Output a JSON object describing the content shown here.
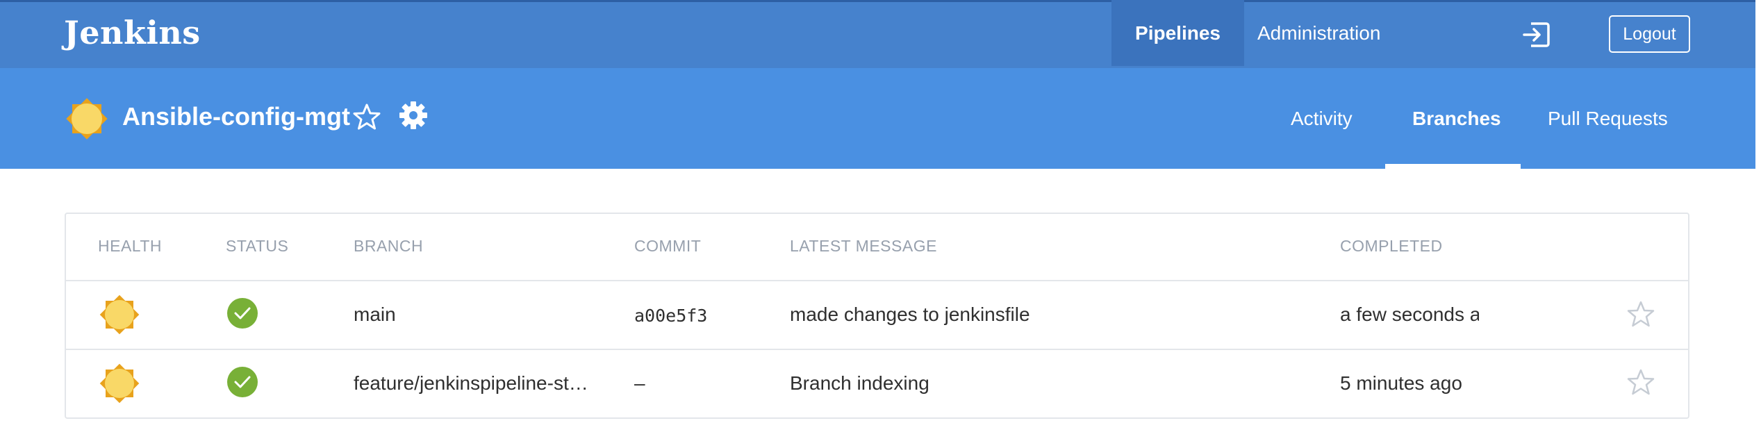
{
  "header": {
    "logo": "Jenkins",
    "nav": {
      "pipelines": "Pipelines",
      "administration": "Administration"
    },
    "logout_label": "Logout"
  },
  "pipeline": {
    "title": "Ansible-config-mgt",
    "tabs": [
      "Activity",
      "Branches",
      "Pull Requests"
    ],
    "active_tab": "Branches"
  },
  "table": {
    "columns": [
      "HEALTH",
      "STATUS",
      "BRANCH",
      "COMMIT",
      "LATEST MESSAGE",
      "COMPLETED"
    ],
    "rows": [
      {
        "health": "sunny-icon",
        "status": "success",
        "branch": "main",
        "commit": "a00e5f3",
        "message": "made changes to jenkinsfile",
        "completed": "a few seconds ago"
      },
      {
        "health": "sunny-icon",
        "status": "success",
        "branch": "feature/jenkinspipeline-st…",
        "commit": "–",
        "message": "Branch indexing",
        "completed": "5 minutes ago"
      }
    ]
  },
  "colors": {
    "topbar": "#4682cd",
    "subbar": "#4a90e2",
    "success": "#78b037",
    "sun": "#f9d867"
  }
}
